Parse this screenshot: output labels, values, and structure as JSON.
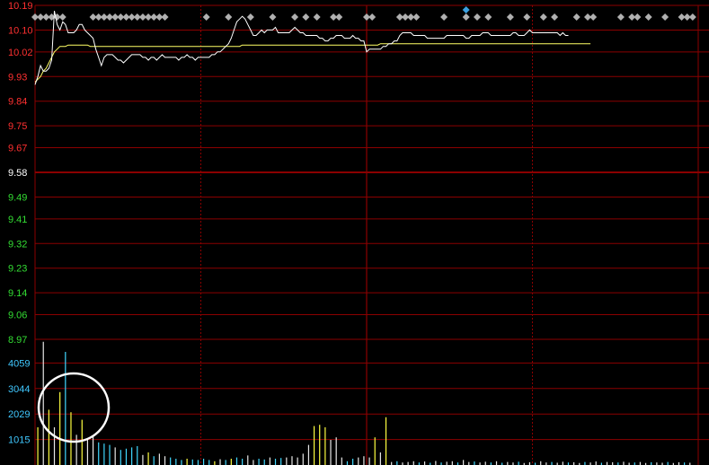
{
  "header": {
    "title": ""
  },
  "chart_data": [
    {
      "type": "line",
      "title": "",
      "price_ticks": [
        10.19,
        10.1,
        10.02,
        9.93,
        9.84,
        9.75,
        9.67,
        9.58,
        9.49,
        9.41,
        9.32,
        9.23,
        9.14,
        9.06,
        8.97
      ],
      "reference_price": 9.58,
      "ylim": [
        8.97,
        10.19
      ],
      "x_minutes": 240,
      "series": [
        {
          "values": [
            9.9,
            9.93,
            9.97,
            9.95,
            9.95,
            9.96,
            9.99,
            10.17,
            10.12,
            10.1,
            10.13,
            10.12,
            10.09,
            10.09,
            10.09,
            10.1,
            10.12,
            10.12,
            10.1,
            10.09,
            10.08,
            10.07,
            10.03,
            10.0,
            9.97,
            10.0,
            10.01,
            10.01,
            10.01,
            10.0,
            9.99,
            9.99,
            9.98,
            9.99,
            10.0,
            10.01,
            10.01,
            10.01,
            10.01,
            10.0,
            10.0,
            9.99,
            10.0,
            10.0,
            9.99,
            10.0,
            10.01,
            10.0,
            10.0,
            10.0,
            10.0,
            10.0,
            9.99,
            10.0,
            10.0,
            10.01,
            10.0,
            10.0,
            9.99,
            10.0,
            10.0,
            10.0,
            10.0,
            10.0,
            10.01,
            10.01,
            10.02,
            10.02,
            10.03,
            10.04,
            10.05,
            10.07,
            10.1,
            10.13,
            10.14,
            10.15,
            10.14,
            10.12,
            10.1,
            10.08,
            10.08,
            10.09,
            10.1,
            10.09,
            10.1,
            10.1,
            10.1,
            10.11,
            10.09,
            10.09,
            10.09,
            10.09,
            10.09,
            10.1,
            10.11,
            10.1,
            10.09,
            10.09,
            10.08,
            10.08,
            10.08,
            10.08,
            10.08,
            10.07,
            10.07,
            10.06,
            10.06,
            10.07,
            10.07,
            10.08,
            10.08,
            10.08,
            10.07,
            10.07,
            10.07,
            10.08,
            10.07,
            10.07,
            10.06,
            10.06,
            10.02,
            10.03,
            10.03,
            10.03,
            10.03,
            10.03,
            10.04,
            10.04,
            10.05,
            10.05,
            10.06,
            10.06,
            10.08,
            10.09,
            10.09,
            10.09,
            10.09,
            10.08,
            10.08,
            10.08,
            10.08,
            10.08,
            10.07,
            10.07,
            10.07,
            10.07,
            10.07,
            10.07,
            10.07,
            10.08,
            10.08,
            10.08,
            10.08,
            10.08,
            10.08,
            10.08,
            10.07,
            10.07,
            10.08,
            10.08,
            10.08,
            10.08,
            10.09,
            10.09,
            10.09,
            10.08,
            10.08,
            10.08,
            10.08,
            10.08,
            10.08,
            10.08,
            10.08,
            10.09,
            10.09,
            10.08,
            10.08,
            10.08,
            10.09,
            10.1,
            10.09,
            10.09,
            10.09,
            10.09,
            10.09,
            10.09,
            10.09,
            10.09,
            10.09,
            10.09,
            10.08,
            10.09,
            10.08,
            10.08
          ]
        },
        {
          "values": [
            9.91,
            9.92,
            9.93,
            9.95,
            9.96,
            9.98,
            10.0,
            10.02,
            10.03,
            10.04,
            10.04,
            10.04,
            10.045,
            10.045,
            10.045,
            10.045,
            10.045,
            10.045,
            10.045,
            10.045,
            10.04,
            10.04,
            10.04,
            10.04,
            10.04,
            10.04,
            10.04,
            10.04,
            10.04,
            10.04,
            10.04,
            10.04,
            10.04,
            10.04,
            10.04,
            10.04,
            10.04,
            10.04,
            10.04,
            10.04,
            10.04,
            10.04,
            10.04,
            10.04,
            10.04,
            10.04,
            10.04,
            10.04,
            10.04,
            10.04,
            10.04,
            10.04,
            10.04,
            10.04,
            10.04,
            10.04,
            10.04,
            10.04,
            10.04,
            10.04,
            10.04,
            10.04,
            10.04,
            10.04,
            10.04,
            10.04,
            10.04,
            10.04,
            10.04,
            10.04,
            10.04,
            10.04,
            10.04,
            10.04,
            10.04,
            10.045,
            10.045,
            10.045,
            10.045,
            10.045,
            10.045,
            10.045,
            10.045,
            10.045,
            10.045,
            10.045,
            10.045,
            10.045,
            10.045,
            10.045,
            10.045,
            10.045,
            10.045,
            10.045,
            10.045,
            10.045,
            10.045,
            10.045,
            10.045,
            10.045,
            10.045,
            10.045,
            10.045,
            10.045,
            10.045,
            10.045,
            10.045,
            10.045,
            10.045,
            10.045,
            10.045,
            10.045,
            10.045,
            10.045,
            10.045,
            10.045,
            10.045,
            10.045,
            10.045,
            10.045,
            10.045,
            10.045,
            10.045,
            10.045,
            10.045,
            10.05,
            10.05,
            10.05,
            10.05,
            10.05,
            10.05,
            10.05,
            10.05,
            10.05,
            10.05,
            10.05,
            10.05,
            10.05,
            10.05,
            10.05,
            10.05,
            10.05,
            10.05,
            10.05,
            10.05,
            10.05,
            10.05,
            10.05,
            10.05,
            10.05,
            10.05,
            10.05,
            10.05,
            10.05,
            10.05,
            10.05,
            10.05,
            10.05,
            10.05,
            10.05,
            10.05,
            10.05,
            10.05,
            10.05,
            10.05,
            10.05,
            10.05,
            10.05,
            10.05,
            10.05,
            10.05,
            10.05,
            10.05,
            10.05,
            10.05,
            10.05,
            10.05,
            10.05,
            10.05,
            10.05,
            10.05,
            10.05,
            10.05,
            10.05,
            10.05,
            10.05,
            10.05,
            10.05,
            10.05,
            10.05,
            10.05,
            10.05,
            10.05,
            10.05,
            10.05,
            10.05,
            10.05,
            10.05,
            10.05,
            10.05,
            10.05,
            10.05
          ]
        }
      ]
    },
    {
      "type": "bar",
      "title": "",
      "volume_ticks": [
        4059,
        3044,
        2029,
        1015
      ],
      "ylim": [
        0,
        5000
      ],
      "volumes": [
        {
          "i": 1,
          "v": 1500,
          "c": "yellow"
        },
        {
          "i": 3,
          "v": 4900,
          "c": "white"
        },
        {
          "i": 5,
          "v": 2200,
          "c": "yellow"
        },
        {
          "i": 7,
          "v": 1500,
          "c": "white"
        },
        {
          "i": 9,
          "v": 2900,
          "c": "yellow"
        },
        {
          "i": 11,
          "v": 4500,
          "c": "cyan"
        },
        {
          "i": 13,
          "v": 2100,
          "c": "yellow"
        },
        {
          "i": 15,
          "v": 1200,
          "c": "white"
        },
        {
          "i": 17,
          "v": 1800,
          "c": "yellow"
        },
        {
          "i": 19,
          "v": 1000,
          "c": "white"
        },
        {
          "i": 21,
          "v": 1150,
          "c": "white"
        },
        {
          "i": 23,
          "v": 900,
          "c": "cyan"
        },
        {
          "i": 25,
          "v": 850,
          "c": "cyan"
        },
        {
          "i": 27,
          "v": 800,
          "c": "cyan"
        },
        {
          "i": 29,
          "v": 700,
          "c": "white"
        },
        {
          "i": 31,
          "v": 600,
          "c": "cyan"
        },
        {
          "i": 33,
          "v": 650,
          "c": "cyan"
        },
        {
          "i": 35,
          "v": 700,
          "c": "cyan"
        },
        {
          "i": 37,
          "v": 750,
          "c": "cyan"
        },
        {
          "i": 39,
          "v": 400,
          "c": "white"
        },
        {
          "i": 41,
          "v": 500,
          "c": "yellow"
        },
        {
          "i": 43,
          "v": 350,
          "c": "cyan"
        },
        {
          "i": 45,
          "v": 450,
          "c": "white"
        },
        {
          "i": 47,
          "v": 350,
          "c": "white"
        },
        {
          "i": 49,
          "v": 300,
          "c": "cyan"
        },
        {
          "i": 51,
          "v": 250,
          "c": "cyan"
        },
        {
          "i": 53,
          "v": 200,
          "c": "cyan"
        },
        {
          "i": 55,
          "v": 250,
          "c": "yellow"
        },
        {
          "i": 57,
          "v": 220,
          "c": "cyan"
        },
        {
          "i": 59,
          "v": 200,
          "c": "cyan"
        },
        {
          "i": 61,
          "v": 250,
          "c": "cyan"
        },
        {
          "i": 63,
          "v": 200,
          "c": "cyan"
        },
        {
          "i": 65,
          "v": 150,
          "c": "yellow"
        },
        {
          "i": 67,
          "v": 230,
          "c": "white"
        },
        {
          "i": 69,
          "v": 200,
          "c": "cyan"
        },
        {
          "i": 71,
          "v": 250,
          "c": "yellow"
        },
        {
          "i": 73,
          "v": 300,
          "c": "cyan"
        },
        {
          "i": 75,
          "v": 250,
          "c": "cyan"
        },
        {
          "i": 77,
          "v": 380,
          "c": "white"
        },
        {
          "i": 79,
          "v": 200,
          "c": "white"
        },
        {
          "i": 81,
          "v": 250,
          "c": "cyan"
        },
        {
          "i": 83,
          "v": 220,
          "c": "cyan"
        },
        {
          "i": 85,
          "v": 300,
          "c": "white"
        },
        {
          "i": 87,
          "v": 250,
          "c": "cyan"
        },
        {
          "i": 89,
          "v": 280,
          "c": "cyan"
        },
        {
          "i": 91,
          "v": 300,
          "c": "white"
        },
        {
          "i": 93,
          "v": 350,
          "c": "white"
        },
        {
          "i": 95,
          "v": 300,
          "c": "white"
        },
        {
          "i": 97,
          "v": 450,
          "c": "white"
        },
        {
          "i": 99,
          "v": 800,
          "c": "white"
        },
        {
          "i": 101,
          "v": 1550,
          "c": "yellow"
        },
        {
          "i": 103,
          "v": 1600,
          "c": "yellow"
        },
        {
          "i": 105,
          "v": 1500,
          "c": "yellow"
        },
        {
          "i": 107,
          "v": 1000,
          "c": "white"
        },
        {
          "i": 109,
          "v": 1100,
          "c": "white"
        },
        {
          "i": 111,
          "v": 300,
          "c": "white"
        },
        {
          "i": 113,
          "v": 150,
          "c": "cyan"
        },
        {
          "i": 115,
          "v": 250,
          "c": "cyan"
        },
        {
          "i": 117,
          "v": 300,
          "c": "white"
        },
        {
          "i": 119,
          "v": 350,
          "c": "white"
        },
        {
          "i": 121,
          "v": 300,
          "c": "white"
        },
        {
          "i": 123,
          "v": 1100,
          "c": "yellow"
        },
        {
          "i": 125,
          "v": 500,
          "c": "white"
        },
        {
          "i": 127,
          "v": 1900,
          "c": "yellow"
        },
        {
          "i": 129,
          "v": 120,
          "c": "white"
        },
        {
          "i": 131,
          "v": 150,
          "c": "cyan"
        },
        {
          "i": 133,
          "v": 100,
          "c": "white"
        },
        {
          "i": 135,
          "v": 120,
          "c": "white"
        },
        {
          "i": 137,
          "v": 150,
          "c": "white"
        },
        {
          "i": 139,
          "v": 100,
          "c": "cyan"
        },
        {
          "i": 141,
          "v": 140,
          "c": "white"
        },
        {
          "i": 143,
          "v": 90,
          "c": "cyan"
        },
        {
          "i": 145,
          "v": 160,
          "c": "white"
        },
        {
          "i": 147,
          "v": 100,
          "c": "cyan"
        },
        {
          "i": 149,
          "v": 130,
          "c": "white"
        },
        {
          "i": 151,
          "v": 150,
          "c": "white"
        },
        {
          "i": 153,
          "v": 100,
          "c": "cyan"
        },
        {
          "i": 155,
          "v": 200,
          "c": "white"
        },
        {
          "i": 157,
          "v": 120,
          "c": "white"
        },
        {
          "i": 159,
          "v": 140,
          "c": "cyan"
        },
        {
          "i": 161,
          "v": 100,
          "c": "white"
        },
        {
          "i": 163,
          "v": 130,
          "c": "white"
        },
        {
          "i": 165,
          "v": 100,
          "c": "cyan"
        },
        {
          "i": 167,
          "v": 150,
          "c": "white"
        },
        {
          "i": 169,
          "v": 90,
          "c": "cyan"
        },
        {
          "i": 171,
          "v": 120,
          "c": "white"
        },
        {
          "i": 173,
          "v": 100,
          "c": "white"
        },
        {
          "i": 175,
          "v": 130,
          "c": "cyan"
        },
        {
          "i": 177,
          "v": 80,
          "c": "white"
        },
        {
          "i": 179,
          "v": 110,
          "c": "white"
        },
        {
          "i": 181,
          "v": 90,
          "c": "cyan"
        },
        {
          "i": 183,
          "v": 150,
          "c": "white"
        },
        {
          "i": 185,
          "v": 100,
          "c": "white"
        },
        {
          "i": 187,
          "v": 120,
          "c": "cyan"
        },
        {
          "i": 189,
          "v": 90,
          "c": "white"
        },
        {
          "i": 191,
          "v": 130,
          "c": "white"
        },
        {
          "i": 193,
          "v": 100,
          "c": "cyan"
        },
        {
          "i": 195,
          "v": 110,
          "c": "white"
        },
        {
          "i": 197,
          "v": 80,
          "c": "white"
        },
        {
          "i": 199,
          "v": 120,
          "c": "cyan"
        },
        {
          "i": 201,
          "v": 100,
          "c": "white"
        },
        {
          "i": 203,
          "v": 140,
          "c": "white"
        },
        {
          "i": 205,
          "v": 90,
          "c": "cyan"
        },
        {
          "i": 207,
          "v": 120,
          "c": "white"
        },
        {
          "i": 209,
          "v": 110,
          "c": "white"
        },
        {
          "i": 211,
          "v": 100,
          "c": "cyan"
        },
        {
          "i": 213,
          "v": 130,
          "c": "white"
        },
        {
          "i": 215,
          "v": 90,
          "c": "white"
        },
        {
          "i": 217,
          "v": 100,
          "c": "cyan"
        },
        {
          "i": 219,
          "v": 120,
          "c": "white"
        },
        {
          "i": 221,
          "v": 80,
          "c": "white"
        },
        {
          "i": 223,
          "v": 110,
          "c": "cyan"
        },
        {
          "i": 225,
          "v": 100,
          "c": "white"
        },
        {
          "i": 227,
          "v": 90,
          "c": "white"
        },
        {
          "i": 229,
          "v": 120,
          "c": "cyan"
        },
        {
          "i": 231,
          "v": 80,
          "c": "white"
        },
        {
          "i": 233,
          "v": 110,
          "c": "white"
        },
        {
          "i": 235,
          "v": 100,
          "c": "cyan"
        },
        {
          "i": 237,
          "v": 90,
          "c": "white"
        }
      ]
    }
  ],
  "signal_markers": {
    "gray_minutes": [
      0,
      2,
      4,
      6,
      8,
      10,
      21,
      23,
      25,
      27,
      29,
      31,
      33,
      35,
      37,
      39,
      41,
      43,
      45,
      47,
      62,
      70,
      78,
      86,
      94,
      98,
      102,
      108,
      110,
      120,
      122,
      132,
      134,
      136,
      138,
      148,
      156,
      160,
      164,
      172,
      178,
      184,
      188,
      196,
      200,
      202,
      212,
      216,
      218,
      222,
      228,
      234,
      236,
      238
    ],
    "blue_minute": 156
  },
  "colors": {
    "background": "#000000",
    "grid": "#8b0000",
    "axis_red": "#ff3030",
    "axis_green": "#33dd33",
    "axis_white": "#ffffff",
    "axis_cyan": "#40c8ff",
    "price_line": "#ffffff",
    "avg_line": "#ffff66",
    "marker_gray": "#b0b0b0",
    "marker_blue": "#3aa0e0",
    "vol_yellow": "#ffff40",
    "vol_white": "#e8e8e8",
    "vol_cyan": "#40d8ff",
    "annotation_circle": "#ffffff"
  },
  "annotation": {
    "shape": "circle",
    "target": "early-volume-spikes"
  }
}
